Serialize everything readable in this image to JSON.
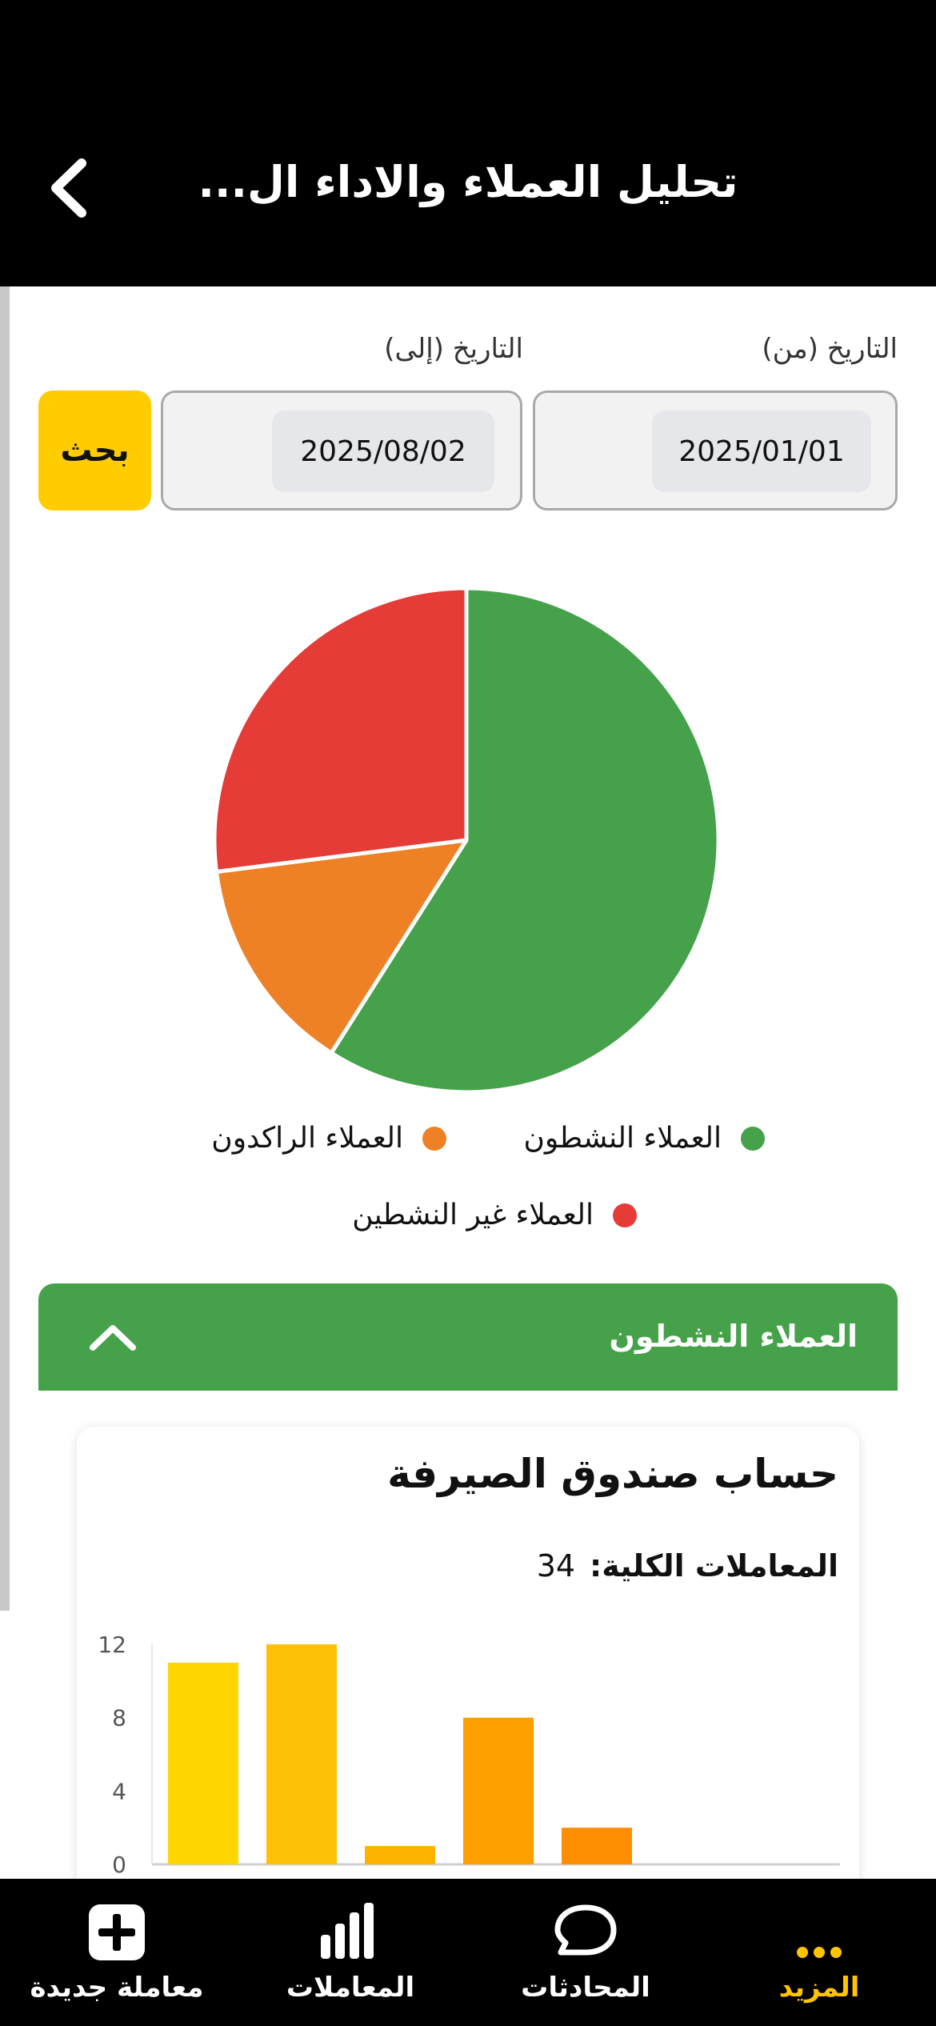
{
  "header": {
    "title": "تحليل العملاء والاداء ال...",
    "back_icon": "chevron-left-icon"
  },
  "filters": {
    "from_label": "التاريخ (من)",
    "to_label": "التاريخ (إلى)",
    "from_value": "2025/01/01",
    "to_value": "2025/08/02",
    "search_label": "بحث",
    "search_color": "#ffcc00"
  },
  "chart_data": [
    {
      "type": "pie",
      "slices": [
        {
          "name": "العملاء النشطون",
          "value": 59,
          "color": "#45a24a"
        },
        {
          "name": "العملاء الراكدون",
          "value": 14,
          "color": "#ee8126"
        },
        {
          "name": "العملاء غير النشطين",
          "value": 27,
          "color": "#e53c38"
        }
      ]
    },
    {
      "type": "bar",
      "values": [
        11,
        12,
        1,
        8,
        2
      ],
      "colors": [
        "#ffd600",
        "#ffc107",
        "#ffb300",
        "#ffa000",
        "#ff8f00"
      ],
      "ylim": [
        0,
        12
      ],
      "yticks": [
        "0",
        "4",
        "8",
        "12"
      ]
    }
  ],
  "section": {
    "title": "العملاء النشطون",
    "color": "#45a24a",
    "toggle_icon": "chevron-up-icon"
  },
  "card": {
    "title": "حساب صندوق الصيرفة",
    "total_label": "المعاملات الكلية:",
    "total_value": "34"
  },
  "bottom_nav": [
    {
      "label": "المزيد",
      "icon": "more-icon",
      "active": true
    },
    {
      "label": "المحادثات",
      "icon": "chat-icon",
      "active": false
    },
    {
      "label": "المعاملات",
      "icon": "bar-chart-icon",
      "active": false
    },
    {
      "label": "معاملة جديدة",
      "icon": "add-square-icon",
      "active": false
    }
  ],
  "colors": {
    "accent": "#ffc400",
    "header_bg": "#000000"
  }
}
